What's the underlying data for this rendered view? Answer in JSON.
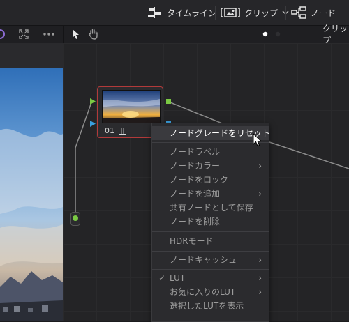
{
  "toolbar": {
    "timeline_label": "タイムライン",
    "clips_label": "クリップ",
    "nodes_label": "ノード"
  },
  "subbar": {
    "right_label": "クリップ"
  },
  "node": {
    "number": "01"
  },
  "context_menu": {
    "items": [
      {
        "label": "ノードグレードをリセット",
        "has_submenu": false,
        "checked": false,
        "active": true
      },
      {
        "label": "ノードラベル",
        "has_submenu": false,
        "checked": false,
        "active": false
      },
      {
        "label": "ノードカラー",
        "has_submenu": true,
        "checked": false,
        "active": false
      },
      {
        "label": "ノードをロック",
        "has_submenu": false,
        "checked": false,
        "active": false
      },
      {
        "label": "ノードを追加",
        "has_submenu": true,
        "checked": false,
        "active": false
      },
      {
        "label": "共有ノードとして保存",
        "has_submenu": false,
        "checked": false,
        "active": false
      },
      {
        "label": "ノードを削除",
        "has_submenu": false,
        "checked": false,
        "active": false
      },
      {
        "label": "HDRモード",
        "has_submenu": false,
        "checked": false,
        "active": false
      },
      {
        "label": "ノードキャッシュ",
        "has_submenu": true,
        "checked": false,
        "active": false
      },
      {
        "label": "LUT",
        "has_submenu": true,
        "checked": true,
        "active": false
      },
      {
        "label": "お気に入りのLUT",
        "has_submenu": true,
        "checked": false,
        "active": false
      },
      {
        "label": "選択したLUTを表示",
        "has_submenu": false,
        "checked": false,
        "active": false
      }
    ]
  },
  "colors": {
    "accent_selected_node": "#b23a3a",
    "port_green": "#7ac943",
    "port_blue": "#3aa0e0"
  }
}
